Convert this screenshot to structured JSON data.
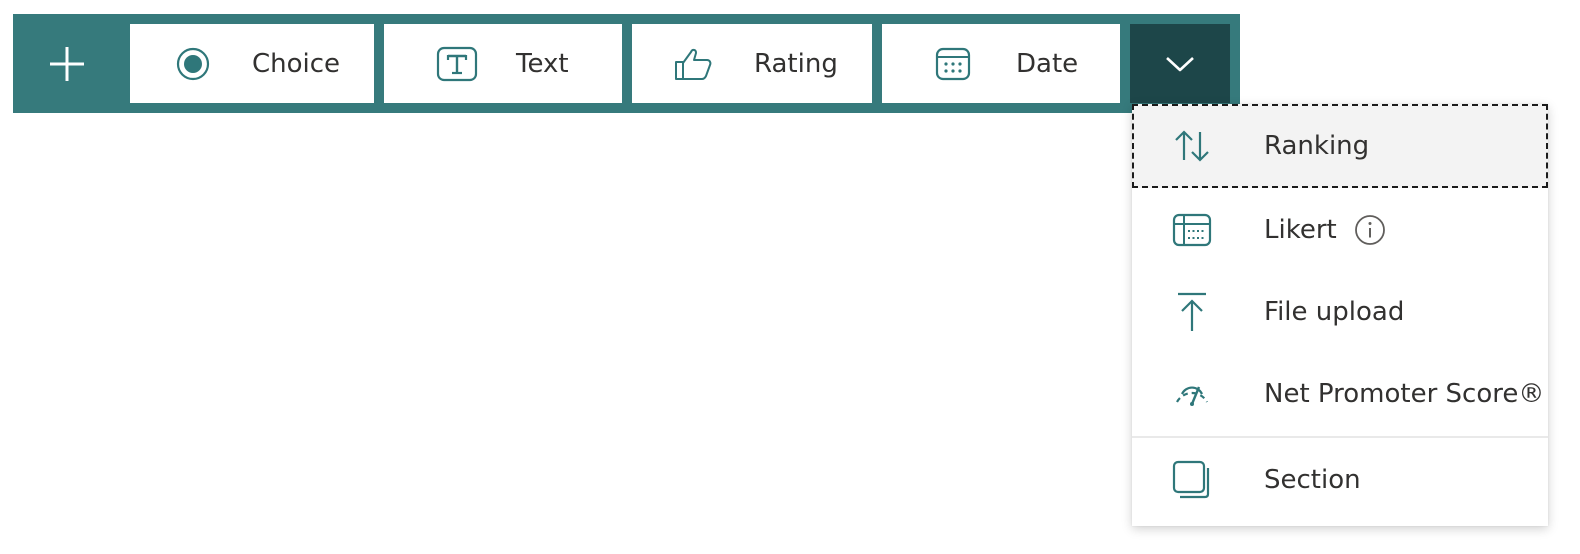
{
  "toolbar": {
    "add_icon": "plus-icon",
    "items": [
      {
        "label": "Choice",
        "icon": "radio-button-icon"
      },
      {
        "label": "Text",
        "icon": "text-box-icon"
      },
      {
        "label": "Rating",
        "icon": "thumbs-up-icon"
      },
      {
        "label": "Date",
        "icon": "calendar-icon"
      }
    ],
    "expand_icon": "chevron-down-icon"
  },
  "menu": {
    "items": [
      {
        "label": "Ranking",
        "icon": "sort-arrows-icon",
        "focused": true
      },
      {
        "label": "Likert",
        "icon": "likert-grid-icon",
        "info_icon": "info-icon"
      },
      {
        "label": "File upload",
        "icon": "upload-icon"
      },
      {
        "label": "Net Promoter Score®",
        "icon": "gauge-icon"
      },
      {
        "label": "Section",
        "icon": "section-pages-icon"
      }
    ]
  },
  "colors": {
    "toolbar_bg": "#367a7c",
    "expand_bg": "#1d4649",
    "icon": "#2f777a",
    "text": "#323130",
    "focused_bg": "#f3f3f3"
  }
}
